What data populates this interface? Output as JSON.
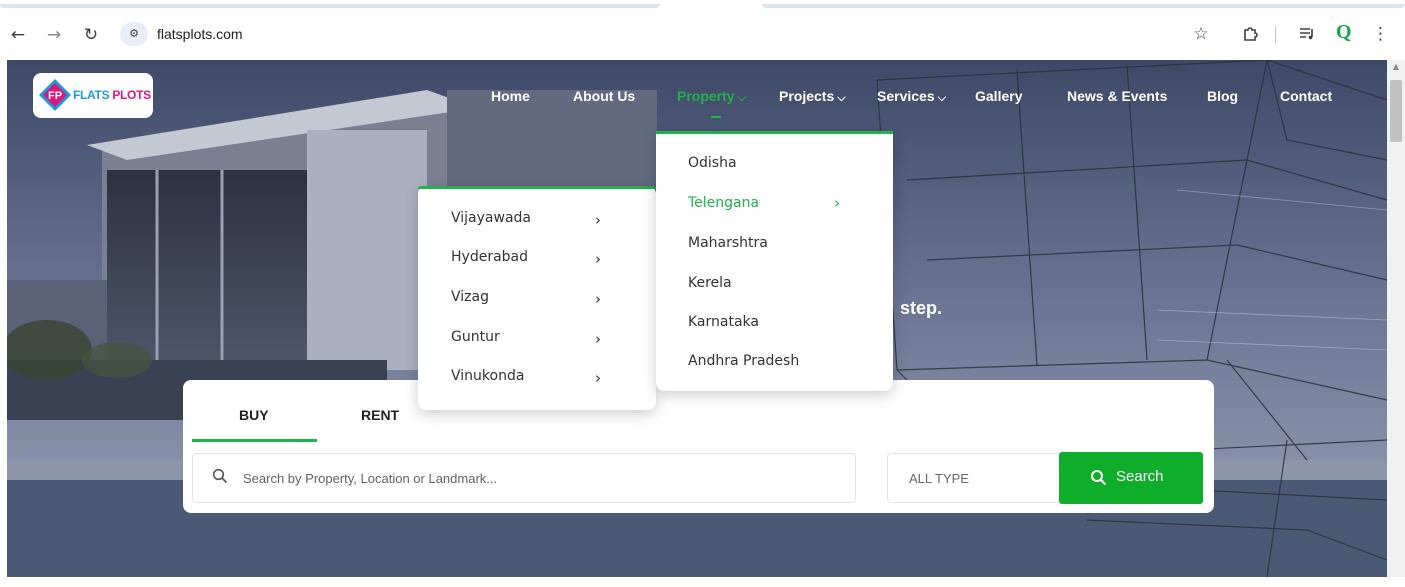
{
  "browser": {
    "url": "flatsplots.com",
    "back_icon": "back-arrow-icon",
    "forward_icon": "forward-arrow-icon",
    "reload_icon": "reload-icon",
    "site_info_icon": "site-settings-icon",
    "bookmark_icon": "star-icon",
    "extensions_icon": "puzzle-icon",
    "media_icon": "media-control-icon",
    "profile_label": "Q",
    "menu_icon": "kebab-menu-icon"
  },
  "site": {
    "logo": {
      "letters": "FP",
      "text_part1": "FLATS",
      "text_part2": "PLOTS"
    },
    "nav": {
      "home": "Home",
      "about": "About Us",
      "property": "Property",
      "projects": "Projects",
      "services": "Services",
      "gallery": "Gallery",
      "news": "News & Events",
      "blog": "Blog",
      "contact": "Contact"
    },
    "chevron_down": "⌵",
    "property_menu": [
      "Odisha",
      "Telengana",
      "Maharshtra",
      "Kerela",
      "Karnataka",
      "Andhra Pradesh"
    ],
    "active_state": "Telengana",
    "city_menu": [
      "Vijayawada",
      "Hyderabad",
      "Vizag",
      "Guntur",
      "Vinukonda"
    ],
    "arrow_glyph": "›",
    "hero_partial_text": "step.",
    "search": {
      "tabs": [
        "BUY",
        "RENT"
      ],
      "active_tab": "BUY",
      "placeholder": "Search by Property, Location or Landmark...",
      "type_label": "ALL TYPE",
      "button_label": "Search"
    }
  },
  "colors": {
    "accent_green": "#22b14c",
    "button_green": "#0fae2a",
    "logo_pink": "#e0157d",
    "logo_blue": "#1d9bd9"
  }
}
